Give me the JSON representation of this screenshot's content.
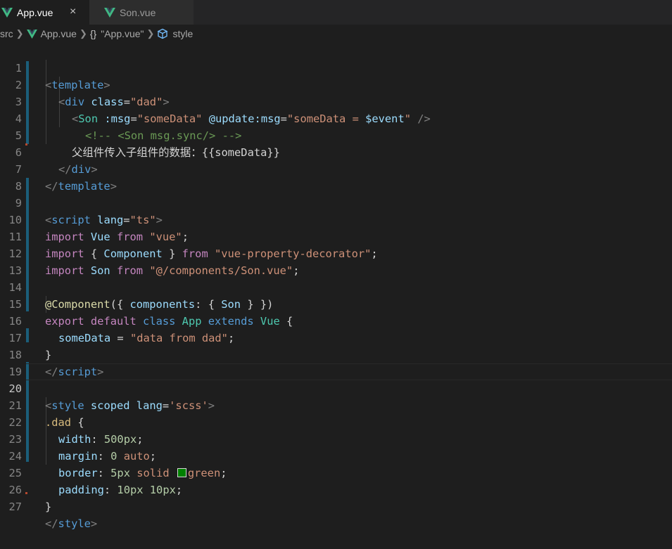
{
  "tabs": [
    {
      "label": "App.vue",
      "active": true
    },
    {
      "label": "Son.vue",
      "active": false
    }
  ],
  "tab_close": "×",
  "breadcrumb": {
    "folder": "src",
    "file": "App.vue",
    "object_icon": "{}",
    "object": "\"App.vue\"",
    "symbol": "style"
  },
  "line_numbers": [
    "1",
    "2",
    "3",
    "4",
    "5",
    "6",
    "7",
    "8",
    "9",
    "10",
    "11",
    "12",
    "13",
    "14",
    "15",
    "16",
    "17",
    "18",
    "19",
    "20",
    "21",
    "22",
    "23",
    "24",
    "25",
    "26",
    "27"
  ],
  "lines": [
    [
      "<",
      "template",
      ">"
    ],
    [
      "<",
      "div",
      " ",
      "class",
      "=",
      "\"dad\"",
      ">"
    ],
    [
      "<",
      "Son",
      " ",
      ":msg",
      "=",
      "\"someData\"",
      " ",
      "@update:msg",
      "=",
      "\"someData = ",
      "$event",
      "\"",
      " />"
    ],
    [
      "<!-- <Son msg.sync/> -->"
    ],
    [
      "父组件传入子组件的数据：",
      "{{someData}}"
    ],
    [
      "</",
      "div",
      ">"
    ],
    [
      "</",
      "template",
      ">"
    ],
    [],
    [
      "<",
      "script",
      " ",
      "lang",
      "=",
      "\"ts\"",
      ">"
    ],
    [
      "import",
      " ",
      "Vue",
      " ",
      "from",
      " ",
      "\"vue\"",
      ";"
    ],
    [
      "import",
      " { ",
      "Component",
      " } ",
      "from",
      " ",
      "\"vue-property-decorator\"",
      ";"
    ],
    [
      "import",
      " ",
      "Son",
      " ",
      "from",
      " ",
      "\"@/components/Son.vue\"",
      ";"
    ],
    [],
    [
      "@Component",
      "({ ",
      "components",
      ": { ",
      "Son",
      " } })"
    ],
    [
      "export",
      " ",
      "default",
      " ",
      "class",
      " ",
      "App",
      " ",
      "extends",
      " ",
      "Vue",
      " {"
    ],
    [
      "someData",
      " = ",
      "\"data from dad\"",
      ";"
    ],
    [
      "}"
    ],
    [
      "</",
      "script",
      ">"
    ],
    [],
    [
      "<",
      "style",
      " ",
      "scoped",
      " ",
      "lang",
      "=",
      "'scss'",
      ">"
    ],
    [
      ".dad",
      " {"
    ],
    [
      "width",
      ": ",
      "500px",
      ";"
    ],
    [
      "margin",
      ": ",
      "0",
      " ",
      "auto",
      ";"
    ],
    [
      "border",
      ": ",
      "5px",
      " ",
      "solid",
      " ",
      "green",
      ";"
    ],
    [
      "padding",
      ": ",
      "10px",
      " ",
      "10px",
      ";"
    ],
    [
      "}"
    ],
    [
      "</",
      "style",
      ">"
    ]
  ],
  "colors": {
    "background": "#1e1e1e",
    "tag": "#569cd6",
    "attribute": "#9cdcfe",
    "string": "#ce9178",
    "keyword": "#c586c0",
    "class": "#4ec9b0",
    "comment": "#6a9955",
    "number": "#b5cea8",
    "swatch_green": "#008000"
  },
  "icons": {
    "tab": "vue-logo-icon",
    "breadcrumb_symbol": "cube-icon"
  }
}
